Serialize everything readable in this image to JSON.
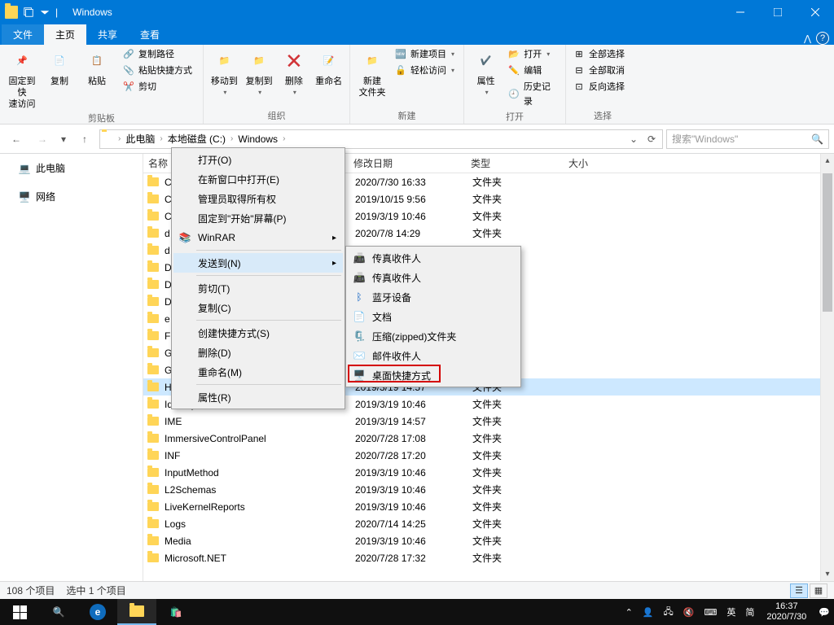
{
  "titlebar": {
    "title": "Windows"
  },
  "tabs": {
    "file": "文件",
    "home": "主页",
    "share": "共享",
    "view": "查看"
  },
  "ribbon": {
    "pin": "固定到快\n速访问",
    "copy": "复制",
    "paste": "粘贴",
    "copy_path": "复制路径",
    "paste_shortcut": "粘贴快捷方式",
    "cut": "剪切",
    "clipboard_label": "剪贴板",
    "move_to": "移动到",
    "copy_to": "复制到",
    "delete": "删除",
    "rename": "重命名",
    "organize_label": "组织",
    "new_folder": "新建\n文件夹",
    "new_item": "新建项目",
    "easy_access": "轻松访问",
    "new_label": "新建",
    "properties": "属性",
    "open": "打开",
    "edit": "编辑",
    "history": "历史记录",
    "open_label": "打开",
    "select_all": "全部选择",
    "select_none": "全部取消",
    "invert": "反向选择",
    "select_label": "选择"
  },
  "address": {
    "crumbs": [
      "此电脑",
      "本地磁盘 (C:)",
      "Windows"
    ],
    "search_placeholder": "搜索\"Windows\""
  },
  "nav": {
    "this_pc": "此电脑",
    "network": "网络"
  },
  "columns": {
    "name": "名称",
    "date": "修改日期",
    "type": "类型",
    "size": "大小"
  },
  "context_menu": {
    "open": "打开(O)",
    "open_new": "在新窗口中打开(E)",
    "admin": "管理员取得所有权",
    "pin_start": "固定到\"开始\"屏幕(P)",
    "winrar": "WinRAR",
    "send_to": "发送到(N)",
    "cut": "剪切(T)",
    "copy": "复制(C)",
    "shortcut": "创建快捷方式(S)",
    "delete": "删除(D)",
    "rename": "重命名(M)",
    "properties": "属性(R)"
  },
  "sub_menu": {
    "fax1": "传真收件人",
    "fax2": "传真收件人",
    "bluetooth": "蓝牙设备",
    "documents": "文档",
    "zip": "压缩(zipped)文件夹",
    "mail": "邮件收件人",
    "desktop_shortcut": "桌面快捷方式"
  },
  "files": [
    {
      "name": "C",
      "date": "2020/7/30 16:33",
      "type": "文件夹"
    },
    {
      "name": "C",
      "date": "2019/10/15 9:56",
      "type": "文件夹"
    },
    {
      "name": "C",
      "date": "2019/3/19 10:46",
      "type": "文件夹"
    },
    {
      "name": "d",
      "date": "2020/7/8 14:29",
      "type": "文件夹"
    },
    {
      "name": "d",
      "date": "",
      "type": ""
    },
    {
      "name": "D",
      "date": "",
      "type": ""
    },
    {
      "name": "D",
      "date": "",
      "type": ""
    },
    {
      "name": "D",
      "date": "",
      "type": ""
    },
    {
      "name": "e",
      "date": "",
      "type": ""
    },
    {
      "name": "F",
      "date": "",
      "type": ""
    },
    {
      "name": "G",
      "date": "",
      "type": ""
    },
    {
      "name": "G",
      "date": "",
      "type": ""
    },
    {
      "name": "H",
      "date": "2019/3/19 14:57",
      "type": "文件夹",
      "selected": true
    },
    {
      "name": "IdentityCRL",
      "date": "2019/3/19 10:46",
      "type": "文件夹"
    },
    {
      "name": "IME",
      "date": "2019/3/19 14:57",
      "type": "文件夹"
    },
    {
      "name": "ImmersiveControlPanel",
      "date": "2020/7/28 17:08",
      "type": "文件夹"
    },
    {
      "name": "INF",
      "date": "2020/7/28 17:20",
      "type": "文件夹"
    },
    {
      "name": "InputMethod",
      "date": "2019/3/19 10:46",
      "type": "文件夹"
    },
    {
      "name": "L2Schemas",
      "date": "2019/3/19 10:46",
      "type": "文件夹"
    },
    {
      "name": "LiveKernelReports",
      "date": "2019/3/19 10:46",
      "type": "文件夹"
    },
    {
      "name": "Logs",
      "date": "2020/7/14 14:25",
      "type": "文件夹"
    },
    {
      "name": "Media",
      "date": "2019/3/19 10:46",
      "type": "文件夹"
    },
    {
      "name": "Microsoft.NET",
      "date": "2020/7/28 17:32",
      "type": "文件夹"
    }
  ],
  "status": {
    "count": "108 个项目",
    "selected": "选中 1 个项目"
  },
  "tray": {
    "ime1": "英",
    "ime2": "简",
    "time": "16:37",
    "date": "2020/7/30"
  }
}
